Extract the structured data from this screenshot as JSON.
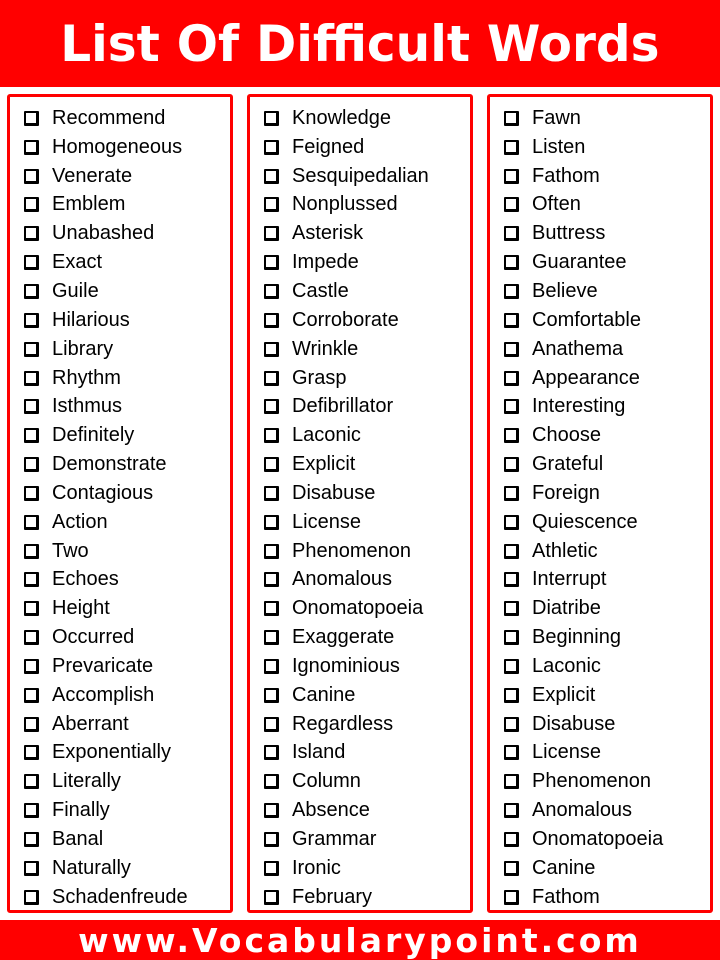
{
  "header": {
    "title": "List Of Difficult Words"
  },
  "colors": {
    "accent": "#ff0000",
    "text": "#000000",
    "background": "#ffffff"
  },
  "icons": {
    "item_marker": "checkbox-icon"
  },
  "columns": [
    {
      "words": [
        "Recommend",
        "Homogeneous",
        "Venerate",
        "Emblem",
        "Unabashed",
        "Exact",
        "Guile",
        "Hilarious",
        "Library",
        "Rhythm",
        "Isthmus",
        "Definitely",
        "Demonstrate",
        "Contagious",
        "Action",
        "Two",
        "Echoes",
        "Height",
        "Occurred",
        "Prevaricate",
        "Accomplish",
        "Aberrant",
        "Exponentially",
        "Literally",
        "Finally",
        "Banal",
        "Naturally",
        "Schadenfreude"
      ]
    },
    {
      "words": [
        "Knowledge",
        "Feigned",
        "Sesquipedalian",
        "Nonplussed",
        "Asterisk",
        "Impede",
        "Castle",
        "Corroborate",
        "Wrinkle",
        "Grasp",
        "Defibrillator",
        "Laconic",
        "Explicit",
        "Disabuse",
        "License",
        "Phenomenon",
        "Anomalous",
        "Onomatopoeia",
        "Exaggerate",
        "Ignominious",
        "Canine",
        "Regardless",
        "Island",
        "Column",
        "Absence",
        "Grammar",
        "Ironic",
        "February"
      ]
    },
    {
      "words": [
        "Fawn",
        "Listen",
        "Fathom",
        "Often",
        "Buttress",
        "Guarantee",
        "Believe",
        "Comfortable",
        "Anathema",
        "Appearance",
        "Interesting",
        "Choose",
        "Grateful",
        "Foreign",
        "Quiescence",
        "Athletic",
        "Interrupt",
        "Diatribe",
        "Beginning",
        "Laconic",
        "Explicit",
        "Disabuse",
        "License",
        "Phenomenon",
        "Anomalous",
        "Onomatopoeia",
        "Canine",
        "Fathom"
      ]
    }
  ],
  "footer": {
    "website": "www.Vocabularypoint.com"
  }
}
